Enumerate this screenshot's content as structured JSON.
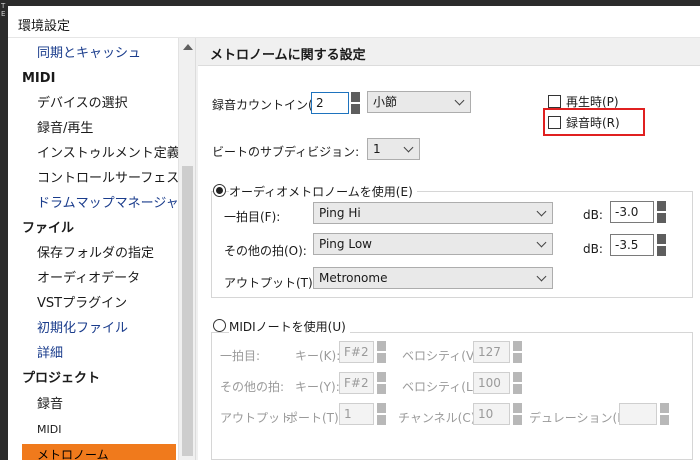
{
  "background_fragment": {
    "line1": "T",
    "line2": "E"
  },
  "window": {
    "title": "環境設定"
  },
  "sidebar": {
    "items": [
      {
        "label": "同期とキャッシュ",
        "type": "sub-link"
      },
      {
        "label": "MIDI",
        "type": "category"
      },
      {
        "label": "デバイスの選択",
        "type": "sub"
      },
      {
        "label": "録音/再生",
        "type": "sub"
      },
      {
        "label": "インストゥルメント定義",
        "type": "sub"
      },
      {
        "label": "コントロールサーフェス",
        "type": "sub"
      },
      {
        "label": "ドラムマップマネージャ",
        "type": "sub-link"
      },
      {
        "label": "ファイル",
        "type": "category"
      },
      {
        "label": "保存フォルダの指定",
        "type": "sub"
      },
      {
        "label": "オーディオデータ",
        "type": "sub"
      },
      {
        "label": "VSTプラグイン",
        "type": "sub"
      },
      {
        "label": "初期化ファイル",
        "type": "sub-link"
      },
      {
        "label": "詳細",
        "type": "sub-link"
      },
      {
        "label": "プロジェクト",
        "type": "category"
      },
      {
        "label": "録音",
        "type": "sub"
      },
      {
        "label": "MIDI",
        "type": "sub-small"
      },
      {
        "label": "メトロノーム",
        "type": "selected"
      }
    ]
  },
  "panel": {
    "title": "メトロノームに関する設定",
    "count_in": {
      "label": "録音カウントイン(I):",
      "value": "2",
      "unit": "小節"
    },
    "playback_checkbox": {
      "label": "再生時(P)",
      "checked": false
    },
    "record_checkbox": {
      "label": "録音時(R)",
      "checked": false,
      "highlight_color": "#e02020"
    },
    "beat_subdivision": {
      "label": "ビートのサブディビジョン:",
      "value": "1"
    },
    "audio_metronome": {
      "label": "オーディオメトロノームを使用(E)",
      "selected": true,
      "first_beat": {
        "label": "一拍目(F):",
        "value": "Ping Hi",
        "db_label": "dB:",
        "db": "-3.0"
      },
      "other_beats": {
        "label": "その他の拍(O):",
        "value": "Ping Low",
        "db_label": "dB:",
        "db": "-3.5"
      },
      "output": {
        "label": "アウトプット(T):",
        "value": "Metronome"
      }
    },
    "midi_note": {
      "label": "MIDIノートを使用(U)",
      "selected": false,
      "first_beat": {
        "label": "一拍目:",
        "key_label": "キー(K):",
        "key": "F#2",
        "velocity_label": "ベロシティ(V):",
        "velocity": "127"
      },
      "other_beats": {
        "label": "その他の拍:",
        "key_label": "キー(Y):",
        "key": "F#2",
        "velocity_label": "ベロシティ(L):",
        "velocity": "100"
      },
      "output": {
        "label": "アウトプット:",
        "port_label": "ポート(T):",
        "port": "1",
        "channel_label": "チャンネル(C):",
        "channel": "10",
        "duration_label": "デュレーション(D):",
        "duration": ""
      }
    }
  },
  "colors": {
    "selected_item": "#f07a1c",
    "link_text": "#1a3c8c",
    "focus_border": "#1e73be"
  }
}
